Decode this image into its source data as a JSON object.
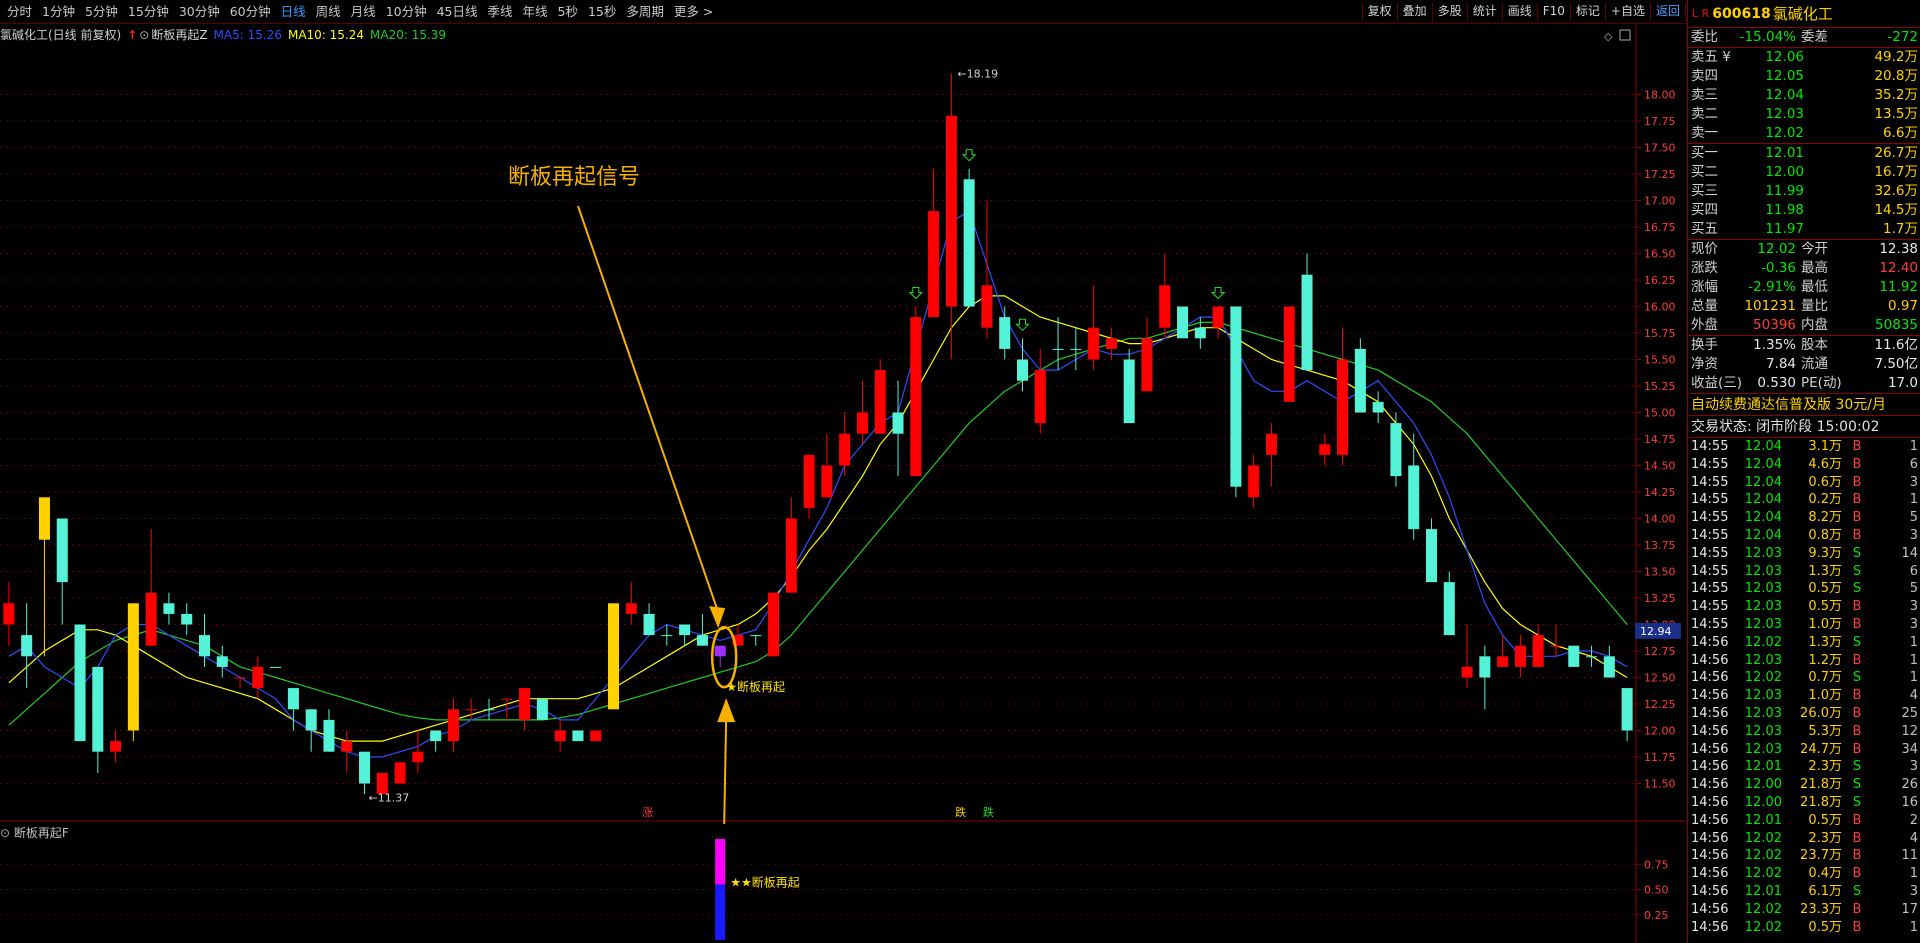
{
  "toolbar": {
    "periods": [
      "分时",
      "1分钟",
      "5分钟",
      "15分钟",
      "30分钟",
      "60分钟",
      "日线",
      "周线",
      "月线",
      "10分钟",
      "45日线",
      "季线",
      "年线",
      "5秒",
      "15秒",
      "多周期",
      "更多 >"
    ],
    "active_period": "日线",
    "tools": [
      "复权",
      "叠加",
      "多股",
      "统计",
      "画线",
      "F10",
      "标记",
      "+自选",
      "返回"
    ]
  },
  "info_line": {
    "stock": "氯碱化工(日线 前复权)",
    "indicator": "断板再起Z",
    "ma5": "MA5: 15.26",
    "ma10": "MA10: 15.24",
    "ma20": "MA20: 15.39"
  },
  "annotations": {
    "big_label": "断板再起信号",
    "signal_label": "★断板再起",
    "sub_signal_label": "★★断板再起",
    "marker_zhang": "涨",
    "marker_die": "跌",
    "marker_die_prefix": "跌",
    "high_label": "18.19",
    "low_label": "11.37",
    "current_price_tag": "12.94"
  },
  "indicator_panel": {
    "label": "断板再起F",
    "yticks": [
      "0.75",
      "0.50",
      "0.25"
    ]
  },
  "colors": {
    "up": "#ff0000",
    "down": "#54f2d6",
    "ma5": "#2f4cff",
    "ma10": "#ffff00",
    "ma20": "#22cc22",
    "signal_bar": "#ffd200",
    "annotation": "#f5b000"
  },
  "chart_data": {
    "type": "candlestick",
    "ylim": [
      11.25,
      18.25
    ],
    "yticks": [
      "18.00",
      "17.75",
      "17.50",
      "17.25",
      "17.00",
      "16.75",
      "16.50",
      "16.25",
      "16.00",
      "15.75",
      "15.50",
      "15.25",
      "15.00",
      "14.75",
      "14.50",
      "14.25",
      "14.00",
      "13.75",
      "13.50",
      "13.25",
      "13.00",
      "12.75",
      "12.50",
      "12.25",
      "12.00",
      "11.75",
      "11.50"
    ],
    "candles": [
      [
        13.2,
        13.0,
        13.4,
        12.8,
        "up"
      ],
      [
        12.7,
        12.9,
        13.2,
        12.4,
        "down"
      ],
      [
        13.8,
        14.2,
        14.2,
        12.7,
        "sig"
      ],
      [
        13.4,
        14.0,
        14.0,
        13.0,
        "down"
      ],
      [
        11.9,
        13.0,
        13.0,
        11.9,
        "down"
      ],
      [
        11.8,
        12.6,
        12.6,
        11.6,
        "down"
      ],
      [
        11.8,
        11.9,
        12.0,
        11.7,
        "up"
      ],
      [
        12.0,
        13.2,
        13.2,
        11.9,
        "sig"
      ],
      [
        12.8,
        13.3,
        13.9,
        12.8,
        "up"
      ],
      [
        13.2,
        13.1,
        13.3,
        13.0,
        "down"
      ],
      [
        13.0,
        13.1,
        13.2,
        12.9,
        "down"
      ],
      [
        12.9,
        12.7,
        13.1,
        12.6,
        "down"
      ],
      [
        12.6,
        12.7,
        12.8,
        12.5,
        "down"
      ],
      [
        12.5,
        12.5,
        12.5,
        12.4,
        "up"
      ],
      [
        12.4,
        12.6,
        12.7,
        12.3,
        "up"
      ],
      [
        12.6,
        12.6,
        12.6,
        12.6,
        "down"
      ],
      [
        12.2,
        12.4,
        12.4,
        12.0,
        "down"
      ],
      [
        12.0,
        12.2,
        12.2,
        11.8,
        "down"
      ],
      [
        11.8,
        12.1,
        12.2,
        11.8,
        "down"
      ],
      [
        11.8,
        11.9,
        12.0,
        11.6,
        "up"
      ],
      [
        11.5,
        11.8,
        11.8,
        11.4,
        "down"
      ],
      [
        11.4,
        11.6,
        11.6,
        11.4,
        "up"
      ],
      [
        11.5,
        11.7,
        11.7,
        11.5,
        "up"
      ],
      [
        11.7,
        11.8,
        12.0,
        11.6,
        "up"
      ],
      [
        11.9,
        12.0,
        12.0,
        11.8,
        "down"
      ],
      [
        11.9,
        12.2,
        12.3,
        11.8,
        "up"
      ],
      [
        12.2,
        12.2,
        12.3,
        12.1,
        "up"
      ],
      [
        12.2,
        12.2,
        12.3,
        12.1,
        "down"
      ],
      [
        12.3,
        12.3,
        12.3,
        12.1,
        "up"
      ],
      [
        12.1,
        12.4,
        12.4,
        12.0,
        "up"
      ],
      [
        12.1,
        12.3,
        12.3,
        12.1,
        "down"
      ],
      [
        12.0,
        11.9,
        12.1,
        11.8,
        "up"
      ],
      [
        11.9,
        12.0,
        12.0,
        11.9,
        "down"
      ],
      [
        11.9,
        12.0,
        12.0,
        11.9,
        "up"
      ],
      [
        12.2,
        13.2,
        13.2,
        12.2,
        "sig"
      ],
      [
        13.1,
        13.2,
        13.4,
        13.0,
        "up"
      ],
      [
        13.1,
        12.9,
        13.2,
        12.9,
        "down"
      ],
      [
        12.9,
        12.9,
        13.0,
        12.8,
        "down"
      ],
      [
        12.9,
        13.0,
        13.0,
        12.8,
        "down"
      ],
      [
        12.8,
        12.9,
        13.1,
        12.8,
        "down"
      ],
      [
        12.7,
        12.8,
        12.8,
        12.6,
        "purple"
      ],
      [
        12.8,
        12.9,
        13.0,
        12.8,
        "up"
      ],
      [
        12.9,
        12.9,
        12.9,
        12.8,
        "down"
      ],
      [
        12.7,
        13.3,
        13.3,
        12.7,
        "up"
      ],
      [
        13.3,
        14.0,
        14.2,
        13.3,
        "up"
      ],
      [
        14.1,
        14.6,
        14.6,
        14.0,
        "up"
      ],
      [
        14.2,
        14.5,
        14.8,
        14.2,
        "up"
      ],
      [
        14.5,
        14.8,
        15.0,
        14.4,
        "up"
      ],
      [
        14.8,
        15.0,
        15.3,
        14.7,
        "up"
      ],
      [
        14.8,
        15.4,
        15.5,
        14.8,
        "up"
      ],
      [
        15.0,
        14.8,
        15.3,
        14.4,
        "down"
      ],
      [
        14.4,
        15.9,
        16.0,
        14.4,
        "up"
      ],
      [
        15.9,
        16.9,
        17.3,
        15.9,
        "up"
      ],
      [
        16.0,
        17.8,
        18.2,
        15.5,
        "up"
      ],
      [
        16.0,
        17.2,
        17.3,
        16.0,
        "down"
      ],
      [
        15.8,
        16.2,
        17.0,
        15.7,
        "up"
      ],
      [
        15.6,
        15.9,
        16.0,
        15.5,
        "down"
      ],
      [
        15.3,
        15.5,
        15.7,
        15.2,
        "down"
      ],
      [
        14.9,
        15.4,
        15.6,
        14.8,
        "up"
      ],
      [
        15.6,
        15.6,
        15.9,
        15.4,
        "down"
      ],
      [
        15.6,
        15.6,
        15.8,
        15.4,
        "down"
      ],
      [
        15.5,
        15.8,
        16.2,
        15.4,
        "up"
      ],
      [
        15.6,
        15.7,
        15.8,
        15.5,
        "up"
      ],
      [
        14.9,
        15.5,
        15.6,
        14.9,
        "down"
      ],
      [
        15.2,
        15.7,
        15.9,
        15.2,
        "up"
      ],
      [
        15.8,
        16.2,
        16.5,
        15.7,
        "up"
      ],
      [
        15.7,
        16.0,
        16.0,
        15.7,
        "down"
      ],
      [
        15.7,
        15.8,
        15.9,
        15.6,
        "down"
      ],
      [
        15.8,
        16.0,
        16.0,
        15.7,
        "up"
      ],
      [
        14.3,
        16.0,
        16.0,
        14.2,
        "down"
      ],
      [
        14.2,
        14.5,
        14.6,
        14.1,
        "up"
      ],
      [
        14.6,
        14.8,
        14.9,
        14.3,
        "up"
      ],
      [
        15.1,
        16.0,
        16.0,
        15.1,
        "up"
      ],
      [
        15.4,
        16.3,
        16.5,
        15.4,
        "down"
      ],
      [
        14.6,
        14.7,
        14.8,
        14.5,
        "up"
      ],
      [
        14.6,
        15.5,
        15.8,
        14.5,
        "up"
      ],
      [
        15.0,
        15.6,
        15.7,
        15.0,
        "down"
      ],
      [
        15.0,
        15.1,
        15.2,
        14.9,
        "down"
      ],
      [
        14.4,
        14.9,
        15.0,
        14.3,
        "down"
      ],
      [
        13.9,
        14.5,
        14.8,
        13.8,
        "down"
      ],
      [
        13.4,
        13.9,
        14.0,
        13.4,
        "down"
      ],
      [
        12.9,
        13.4,
        13.5,
        12.9,
        "down"
      ],
      [
        12.5,
        12.6,
        13.0,
        12.4,
        "up"
      ],
      [
        12.5,
        12.7,
        12.8,
        12.2,
        "down"
      ],
      [
        12.6,
        12.7,
        12.9,
        12.6,
        "up"
      ],
      [
        12.6,
        12.8,
        12.9,
        12.5,
        "up"
      ],
      [
        12.6,
        12.9,
        13.0,
        12.6,
        "up"
      ],
      [
        12.8,
        12.8,
        13.0,
        12.7,
        "up"
      ],
      [
        12.6,
        12.8,
        12.8,
        12.6,
        "down"
      ],
      [
        12.7,
        12.7,
        12.8,
        12.6,
        "down"
      ],
      [
        12.5,
        12.7,
        12.8,
        12.5,
        "down"
      ],
      [
        12.0,
        12.4,
        12.4,
        11.9,
        "down"
      ]
    ],
    "ma5": [
      12.7,
      12.8,
      12.6,
      12.5,
      12.4,
      12.6,
      12.9,
      13.0,
      13.0,
      12.9,
      12.8,
      12.7,
      12.6,
      12.5,
      12.4,
      12.3,
      12.1,
      12.0,
      11.9,
      11.8,
      11.75,
      11.75,
      11.8,
      11.85,
      11.95,
      12.0,
      12.1,
      12.15,
      12.2,
      12.25,
      12.2,
      12.1,
      12.1,
      12.3,
      12.5,
      12.7,
      12.9,
      13.0,
      12.95,
      12.9,
      12.85,
      12.9,
      12.95,
      13.2,
      13.5,
      13.8,
      14.1,
      14.5,
      14.7,
      14.9,
      15.0,
      15.6,
      16.2,
      16.8,
      16.9,
      16.4,
      15.9,
      15.6,
      15.4,
      15.4,
      15.5,
      15.6,
      15.55,
      15.55,
      15.6,
      15.7,
      15.8,
      15.9,
      15.9,
      15.6,
      15.3,
      15.2,
      15.2,
      15.3,
      15.2,
      15.1,
      15.2,
      15.3,
      15.1,
      14.9,
      14.6,
      14.2,
      13.7,
      13.2,
      12.9,
      12.7,
      12.7,
      12.7,
      12.75,
      12.75,
      12.7,
      12.6
    ],
    "ma10": [
      12.45,
      12.6,
      12.75,
      12.85,
      12.95,
      12.95,
      12.9,
      12.8,
      12.7,
      12.6,
      12.5,
      12.45,
      12.4,
      12.35,
      12.3,
      12.2,
      12.1,
      12.0,
      11.95,
      11.9,
      11.9,
      11.9,
      11.95,
      12.0,
      12.05,
      12.1,
      12.15,
      12.2,
      12.25,
      12.3,
      12.3,
      12.3,
      12.3,
      12.35,
      12.4,
      12.5,
      12.6,
      12.7,
      12.8,
      12.9,
      12.95,
      13.0,
      13.1,
      13.25,
      13.45,
      13.7,
      13.9,
      14.15,
      14.4,
      14.7,
      14.9,
      15.2,
      15.5,
      15.8,
      16.0,
      16.1,
      16.1,
      16.0,
      15.9,
      15.85,
      15.8,
      15.75,
      15.7,
      15.65,
      15.65,
      15.7,
      15.75,
      15.8,
      15.8,
      15.7,
      15.6,
      15.5,
      15.45,
      15.4,
      15.35,
      15.3,
      15.2,
      15.1,
      14.9,
      14.7,
      14.4,
      14.0,
      13.7,
      13.4,
      13.15,
      13.0,
      12.9,
      12.8,
      12.75,
      12.7,
      12.6,
      12.5
    ],
    "ma20": [
      12.05,
      12.2,
      12.35,
      12.5,
      12.65,
      12.75,
      12.85,
      12.9,
      12.95,
      12.9,
      12.85,
      12.8,
      12.7,
      12.6,
      12.55,
      12.5,
      12.45,
      12.4,
      12.35,
      12.3,
      12.25,
      12.2,
      12.15,
      12.12,
      12.1,
      12.1,
      12.1,
      12.1,
      12.1,
      12.1,
      12.1,
      12.12,
      12.15,
      12.2,
      12.25,
      12.3,
      12.35,
      12.4,
      12.45,
      12.5,
      12.55,
      12.6,
      12.65,
      12.75,
      12.9,
      13.1,
      13.3,
      13.5,
      13.7,
      13.9,
      14.1,
      14.3,
      14.5,
      14.7,
      14.9,
      15.05,
      15.2,
      15.3,
      15.4,
      15.5,
      15.55,
      15.6,
      15.65,
      15.7,
      15.7,
      15.75,
      15.8,
      15.85,
      15.85,
      15.8,
      15.75,
      15.7,
      15.65,
      15.6,
      15.55,
      15.5,
      15.45,
      15.4,
      15.3,
      15.2,
      15.1,
      14.95,
      14.8,
      14.6,
      14.4,
      14.2,
      14.0,
      13.8,
      13.6,
      13.4,
      13.2,
      13.0
    ]
  },
  "quote_panel": {
    "code": "600618",
    "name": "氯碱化工",
    "weibi": {
      "label": "委比",
      "value": "-15.04%",
      "label2": "委差",
      "value2": "-272"
    },
    "asks": [
      {
        "label": "卖五 ¥",
        "price": "12.06",
        "vol": "49.2万"
      },
      {
        "label": "卖四",
        "price": "12.05",
        "vol": "20.8万"
      },
      {
        "label": "卖三",
        "price": "12.04",
        "vol": "35.2万"
      },
      {
        "label": "卖二",
        "price": "12.03",
        "vol": "13.5万"
      },
      {
        "label": "卖一",
        "price": "12.02",
        "vol": "6.6万"
      }
    ],
    "bids": [
      {
        "label": "买一",
        "price": "12.01",
        "vol": "26.7万"
      },
      {
        "label": "买二",
        "price": "12.00",
        "vol": "16.7万"
      },
      {
        "label": "买三",
        "price": "11.99",
        "vol": "32.6万"
      },
      {
        "label": "买四",
        "price": "11.98",
        "vol": "14.5万"
      },
      {
        "label": "买五",
        "price": "11.97",
        "vol": "1.7万"
      }
    ],
    "stats1": [
      {
        "l1": "现价",
        "v1": "12.02",
        "c1": "green",
        "l2": "今开",
        "v2": "12.38",
        "c2": "white"
      },
      {
        "l1": "涨跌",
        "v1": "-0.36",
        "c1": "green",
        "l2": "最高",
        "v2": "12.40",
        "c2": "red"
      },
      {
        "l1": "涨幅",
        "v1": "-2.91%",
        "c1": "green",
        "l2": "最低",
        "v2": "11.92",
        "c2": "green"
      },
      {
        "l1": "总量",
        "v1": "101231",
        "c1": "yellow",
        "l2": "量比",
        "v2": "0.97",
        "c2": "yellow"
      },
      {
        "l1": "外盘",
        "v1": "50396",
        "c1": "red",
        "l2": "内盘",
        "v2": "50835",
        "c2": "green"
      }
    ],
    "stats2": [
      {
        "l1": "换手",
        "v1": "1.35%",
        "c1": "white",
        "l2": "股本",
        "v2": "11.6亿",
        "c2": "white"
      },
      {
        "l1": "净资",
        "v1": "7.84",
        "c1": "white",
        "l2": "流通",
        "v2": "7.50亿",
        "c2": "white"
      },
      {
        "l1": "收益(三)",
        "v1": "0.530",
        "c1": "white",
        "l2": "PE(动)",
        "v2": "17.0",
        "c2": "white"
      }
    ],
    "promo": "自动续费通达信普及版  30元/月",
    "status": "交易状态: 闭市阶段 15:00:02",
    "ticks": [
      [
        "14:55",
        "12.04",
        "3.1万",
        "B",
        "1"
      ],
      [
        "14:55",
        "12.04",
        "4.6万",
        "B",
        "6"
      ],
      [
        "14:55",
        "12.04",
        "0.6万",
        "B",
        "3"
      ],
      [
        "14:55",
        "12.04",
        "0.2万",
        "B",
        "1"
      ],
      [
        "14:55",
        "12.04",
        "8.2万",
        "B",
        "5"
      ],
      [
        "14:55",
        "12.04",
        "0.8万",
        "B",
        "3"
      ],
      [
        "14:55",
        "12.03",
        "9.3万",
        "S",
        "14"
      ],
      [
        "14:55",
        "12.03",
        "1.3万",
        "S",
        "6"
      ],
      [
        "14:55",
        "12.03",
        "0.5万",
        "S",
        "5"
      ],
      [
        "14:55",
        "12.03",
        "0.5万",
        "B",
        "3"
      ],
      [
        "14:55",
        "12.03",
        "1.0万",
        "B",
        "3"
      ],
      [
        "14:56",
        "12.02",
        "1.3万",
        "S",
        "1"
      ],
      [
        "14:56",
        "12.03",
        "1.2万",
        "B",
        "1"
      ],
      [
        "14:56",
        "12.02",
        "0.7万",
        "S",
        "1"
      ],
      [
        "14:56",
        "12.03",
        "1.0万",
        "B",
        "4"
      ],
      [
        "14:56",
        "12.03",
        "26.0万",
        "B",
        "25"
      ],
      [
        "14:56",
        "12.03",
        "5.3万",
        "B",
        "12"
      ],
      [
        "14:56",
        "12.03",
        "24.7万",
        "B",
        "34"
      ],
      [
        "14:56",
        "12.01",
        "2.3万",
        "S",
        "3"
      ],
      [
        "14:56",
        "12.00",
        "21.8万",
        "S",
        "26"
      ],
      [
        "14:56",
        "12.00",
        "21.8万",
        "S",
        "16"
      ],
      [
        "14:56",
        "12.01",
        "0.5万",
        "B",
        "2"
      ],
      [
        "14:56",
        "12.02",
        "2.3万",
        "B",
        "4"
      ],
      [
        "14:56",
        "12.02",
        "23.7万",
        "B",
        "11"
      ],
      [
        "14:56",
        "12.02",
        "0.4万",
        "B",
        "1"
      ],
      [
        "14:56",
        "12.01",
        "6.1万",
        "S",
        "3"
      ],
      [
        "14:56",
        "12.02",
        "23.3万",
        "B",
        "17"
      ],
      [
        "14:56",
        "12.02",
        "0.5万",
        "B",
        "1"
      ]
    ]
  }
}
